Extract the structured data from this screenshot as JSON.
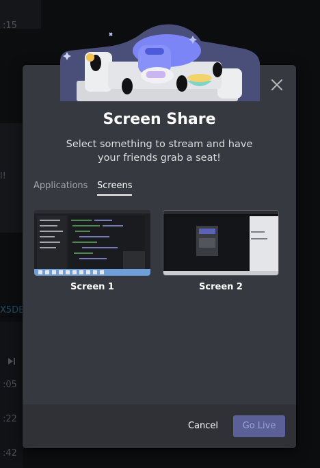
{
  "background": {
    "timestamps": [
      ":15",
      ":05",
      ":22",
      ":42"
    ],
    "fragments": [
      "l!",
      "X5DB"
    ]
  },
  "modal": {
    "title": "Screen Share",
    "subtitle": "Select something to stream and have your friends grab a seat!",
    "tabs": [
      {
        "label": "Applications",
        "active": false
      },
      {
        "label": "Screens",
        "active": true
      }
    ],
    "sources": [
      {
        "label": "Screen 1"
      },
      {
        "label": "Screen 2"
      }
    ],
    "buttons": {
      "cancel": "Cancel",
      "go_live": "Go Live"
    },
    "colors": {
      "accent": "#5865f2",
      "go_live_disabled": "#5b6096",
      "modal_bg": "#36393f",
      "footer_bg": "#2f3136"
    },
    "icons": {
      "close": "close-icon",
      "hero": "discord-couch-illustration"
    }
  }
}
